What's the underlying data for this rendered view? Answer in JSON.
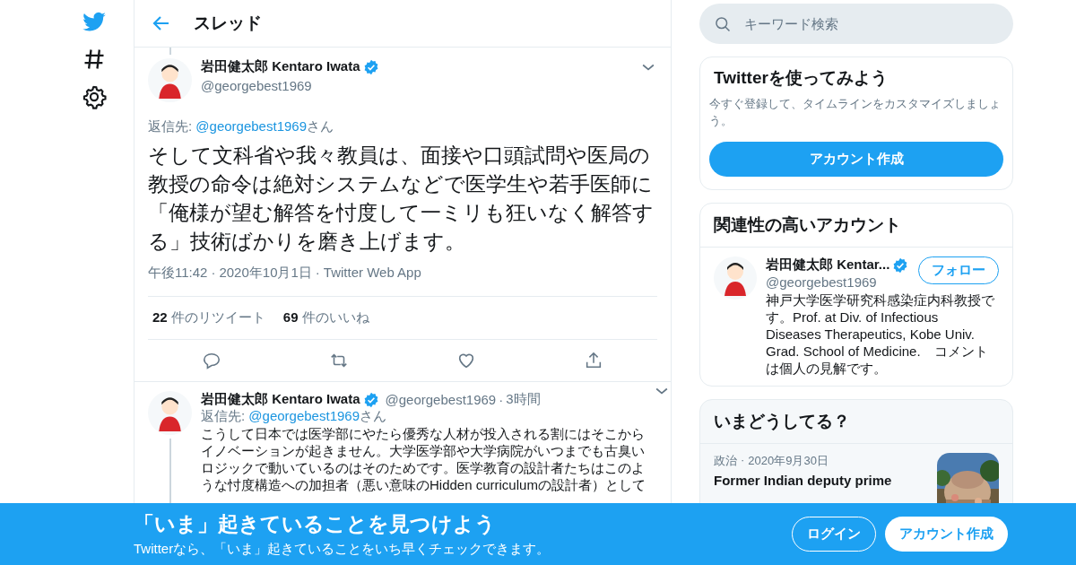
{
  "header": {
    "title": "スレッド"
  },
  "main_tweet": {
    "name": "岩田健太郎 Kentaro Iwata",
    "verified": true,
    "handle": "@georgebest1969",
    "reply_prefix": "返信先: ",
    "reply_to": "@georgebest1969",
    "reply_suffix": "さん",
    "text": "そして文科省や我々教員は、面接や口頭試問や医局の教授の命令は絶対システムなどで医学生や若手医師に「俺様が望む解答を忖度して一ミリも狂いなく解答する」技術ばかりを磨き上げます。",
    "meta": [
      "午後11:42",
      "2020年10月1日",
      "Twitter Web App"
    ],
    "meta_separator": "·",
    "stats": [
      {
        "count": "22",
        "label": "件のリツイート"
      },
      {
        "count": "69",
        "label": "件のいいね"
      }
    ]
  },
  "reply_tweet": {
    "name": "岩田健太郎 Kentaro Iwata",
    "verified": true,
    "handle": "@georgebest1969",
    "separator": "·",
    "time": "3時間",
    "reply_prefix": "返信先: ",
    "reply_to": "@georgebest1969",
    "reply_suffix": "さん",
    "text": "こうして日本では医学部にやたら優秀な人材が投入される割にはそこからイノベーションが起きません。大学医学部や大学病院がいつまでも古臭いロジックで動いているのはそのためです。医学教育の設計者たちはこのような忖度構造への加担者（悪い意味のHidden curriculumの設計者）として"
  },
  "search": {
    "placeholder": "キーワード検索"
  },
  "signup_card": {
    "title": "Twitterを使ってみよう",
    "text": "今すぐ登録して、タイムラインをカスタマイズしましょう。",
    "button": "アカウント作成"
  },
  "related": {
    "title": "関連性の高いアカウント",
    "account": {
      "name": "岩田健太郎 Kentar...",
      "verified": true,
      "handle": "@georgebest1969",
      "bio": "神戸大学医学研究科感染症内科教授です。Prof. at Div. of Infectious Diseases Therapeutics, Kobe Univ. Grad. School of Medicine.　コメントは個人の見解です。",
      "button": "フォロー"
    }
  },
  "trends": {
    "title": "いまどうしてる？",
    "items": [
      {
        "category": "政治",
        "separator": "·",
        "date": "2020年9月30日",
        "headline": "Former Indian deputy prime",
        "kind": "picture"
      }
    ]
  },
  "banner": {
    "title": "「いま」起きていることを見つけよう",
    "subtitle": "Twitterなら、「いま」起きていることをいち早くチェックできます。",
    "buttons": [
      {
        "label": "ログイン",
        "kind": "outline"
      },
      {
        "label": "アカウント作成",
        "kind": "filled"
      }
    ]
  }
}
